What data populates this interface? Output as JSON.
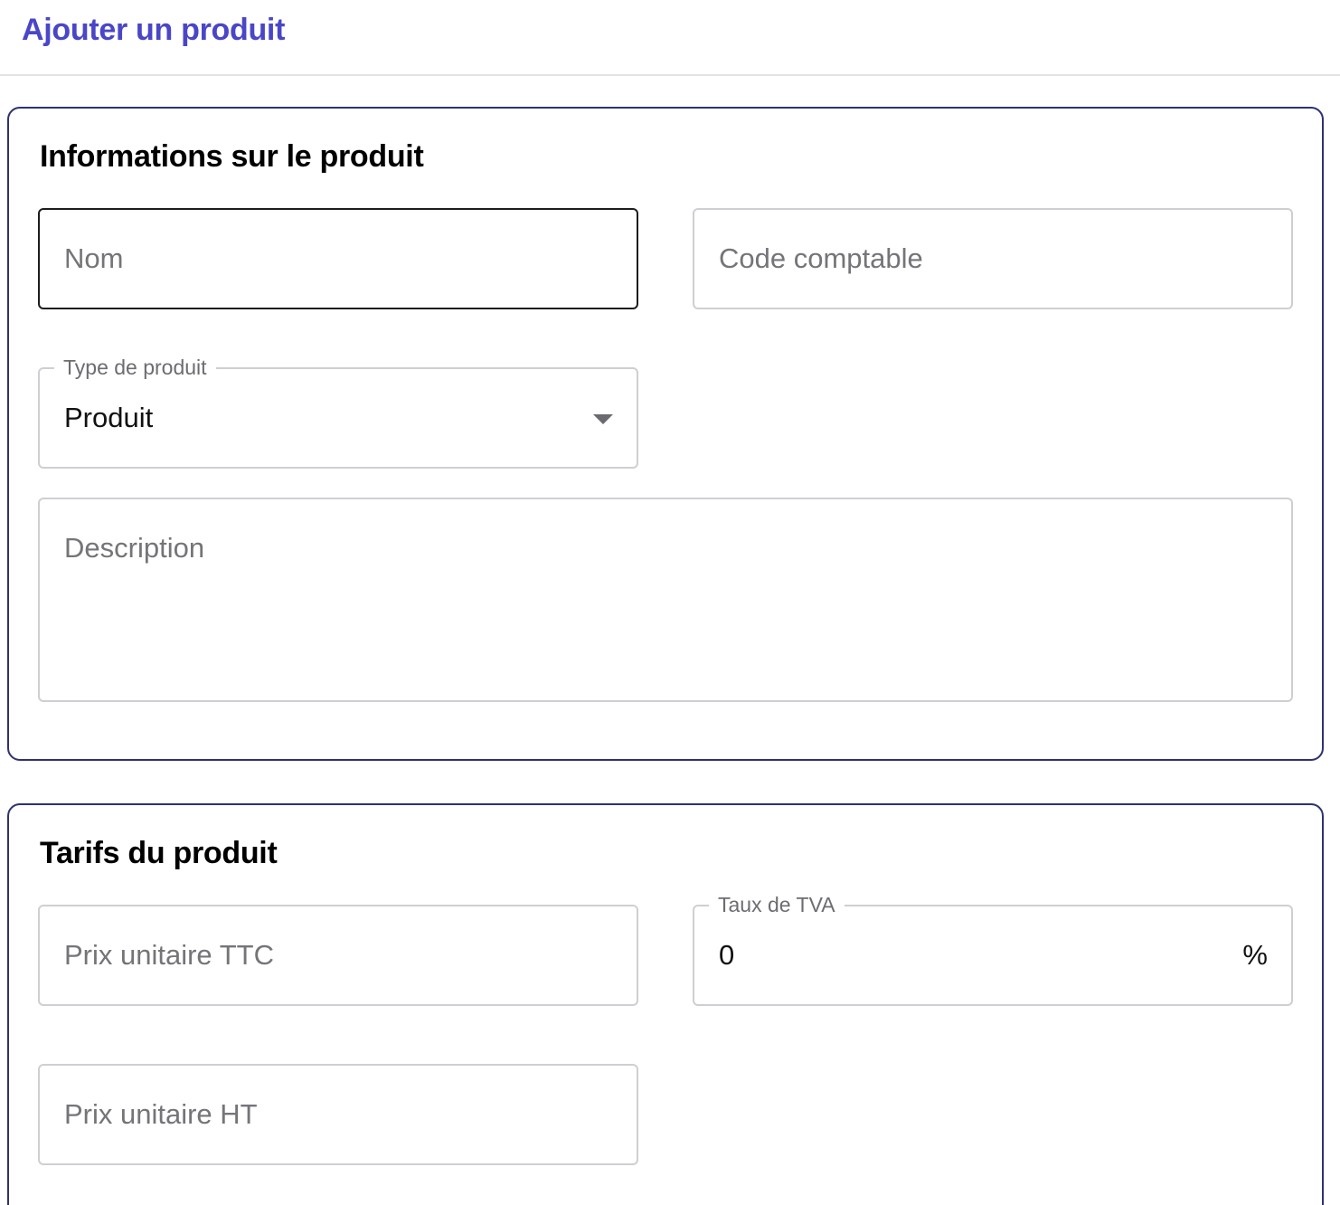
{
  "colors": {
    "accent": "#4A46C8",
    "card_border": "#2E3270",
    "field_border": "#CFCFD3",
    "focused_border": "#1D1D1F",
    "placeholder": "#747479"
  },
  "header": {
    "title": "Ajouter un produit"
  },
  "product_info": {
    "title": "Informations sur le produit",
    "name": {
      "placeholder": "Nom",
      "value": ""
    },
    "accounting_code": {
      "placeholder": "Code comptable",
      "value": ""
    },
    "product_type": {
      "label": "Type de produit",
      "selected": "Produit",
      "icon": "chevron-down-icon"
    },
    "description": {
      "placeholder": "Description",
      "value": ""
    }
  },
  "pricing": {
    "title": "Tarifs du produit",
    "unit_price_ttc": {
      "placeholder": "Prix unitaire TTC",
      "value": ""
    },
    "vat_rate": {
      "label": "Taux de TVA",
      "value": "0",
      "suffix": "%"
    },
    "unit_price_ht": {
      "placeholder": "Prix unitaire HT",
      "value": ""
    }
  }
}
